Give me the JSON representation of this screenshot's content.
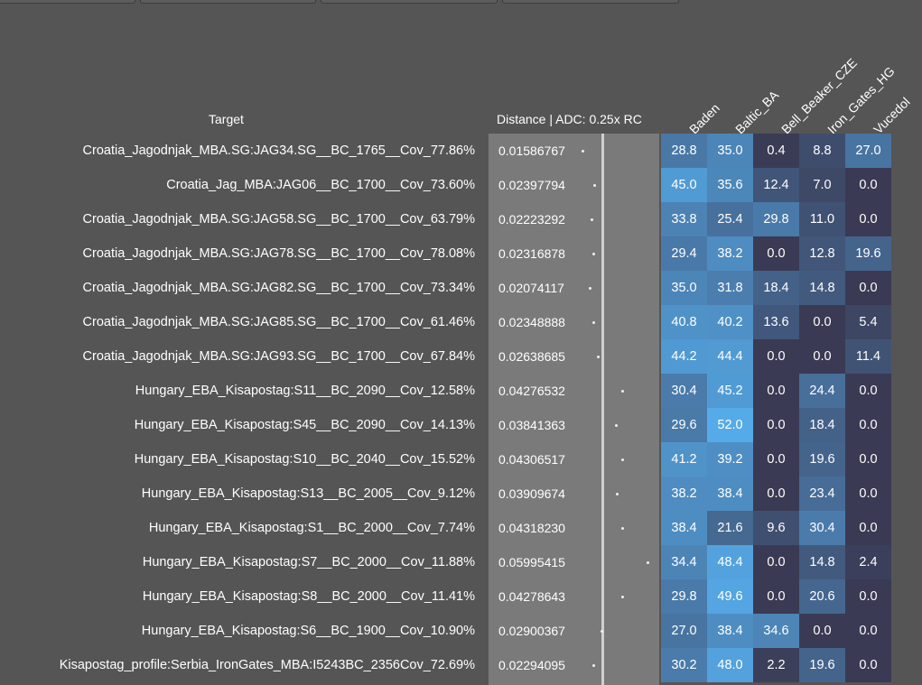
{
  "headers": {
    "target": "Target",
    "distance": "Distance | ADC: 0.25x RC",
    "columns": [
      "Baden",
      "Baltic_BA",
      "Bell_Beaker_CZE",
      "Iron_Gates_HG",
      "Vucedol"
    ]
  },
  "rows": [
    {
      "target": "Croatia_Jagodnjak_MBA.SG:JAG34.SG__BC_1765__Cov_77.86%",
      "distance": "0.01586767",
      "values": [
        "28.8",
        "35.0",
        "0.4",
        "8.8",
        "27.0"
      ]
    },
    {
      "target": "Croatia_Jag_MBA:JAG06__BC_1700__Cov_73.60%",
      "distance": "0.02397794",
      "values": [
        "45.0",
        "35.6",
        "12.4",
        "7.0",
        "0.0"
      ]
    },
    {
      "target": "Croatia_Jagodnjak_MBA.SG:JAG58.SG__BC_1700__Cov_63.79%",
      "distance": "0.02223292",
      "values": [
        "33.8",
        "25.4",
        "29.8",
        "11.0",
        "0.0"
      ]
    },
    {
      "target": "Croatia_Jagodnjak_MBA.SG:JAG78.SG__BC_1700__Cov_78.08%",
      "distance": "0.02316878",
      "values": [
        "29.4",
        "38.2",
        "0.0",
        "12.8",
        "19.6"
      ]
    },
    {
      "target": "Croatia_Jagodnjak_MBA.SG:JAG82.SG__BC_1700__Cov_73.34%",
      "distance": "0.02074117",
      "values": [
        "35.0",
        "31.8",
        "18.4",
        "14.8",
        "0.0"
      ]
    },
    {
      "target": "Croatia_Jagodnjak_MBA.SG:JAG85.SG__BC_1700__Cov_61.46%",
      "distance": "0.02348888",
      "values": [
        "40.8",
        "40.2",
        "13.6",
        "0.0",
        "5.4"
      ]
    },
    {
      "target": "Croatia_Jagodnjak_MBA.SG:JAG93.SG__BC_1700__Cov_67.84%",
      "distance": "0.02638685",
      "values": [
        "44.2",
        "44.4",
        "0.0",
        "0.0",
        "11.4"
      ]
    },
    {
      "target": "Hungary_EBA_Kisapostag:S11__BC_2090__Cov_12.58%",
      "distance": "0.04276532",
      "values": [
        "30.4",
        "45.2",
        "0.0",
        "24.4",
        "0.0"
      ]
    },
    {
      "target": "Hungary_EBA_Kisapostag:S45__BC_2090__Cov_14.13%",
      "distance": "0.03841363",
      "values": [
        "29.6",
        "52.0",
        "0.0",
        "18.4",
        "0.0"
      ]
    },
    {
      "target": "Hungary_EBA_Kisapostag:S10__BC_2040__Cov_15.52%",
      "distance": "0.04306517",
      "values": [
        "41.2",
        "39.2",
        "0.0",
        "19.6",
        "0.0"
      ]
    },
    {
      "target": "Hungary_EBA_Kisapostag:S13__BC_2005__Cov_9.12%",
      "distance": "0.03909674",
      "values": [
        "38.2",
        "38.4",
        "0.0",
        "23.4",
        "0.0"
      ]
    },
    {
      "target": "Hungary_EBA_Kisapostag:S1__BC_2000__Cov_7.74%",
      "distance": "0.04318230",
      "values": [
        "38.4",
        "21.6",
        "9.6",
        "30.4",
        "0.0"
      ]
    },
    {
      "target": "Hungary_EBA_Kisapostag:S7__BC_2000__Cov_11.88%",
      "distance": "0.05995415",
      "values": [
        "34.4",
        "48.4",
        "0.0",
        "14.8",
        "2.4"
      ]
    },
    {
      "target": "Hungary_EBA_Kisapostag:S8__BC_2000__Cov_11.41%",
      "distance": "0.04278643",
      "values": [
        "29.8",
        "49.6",
        "0.0",
        "20.6",
        "0.0"
      ]
    },
    {
      "target": "Hungary_EBA_Kisapostag:S6__BC_1900__Cov_10.90%",
      "distance": "0.02900367",
      "values": [
        "27.0",
        "38.4",
        "34.6",
        "0.0",
        "0.0"
      ]
    },
    {
      "target": "Kisapostag_profile:Serbia_IronGates_MBA:I5243BC_2356Cov_72.69%",
      "distance": "0.02294095",
      "values": [
        "30.2",
        "48.0",
        "2.2",
        "19.6",
        "0.0"
      ]
    }
  ]
}
